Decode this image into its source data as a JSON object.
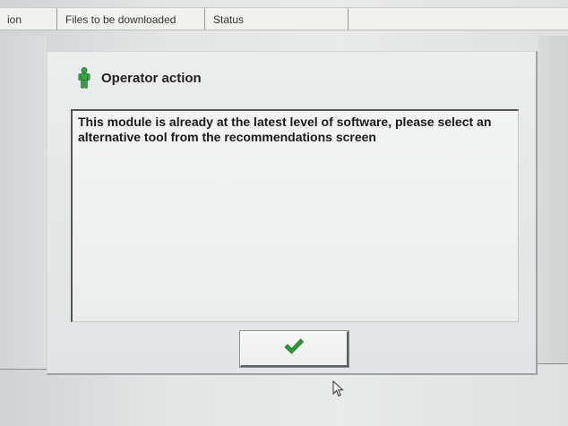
{
  "table_header": {
    "columns": [
      "ion",
      "Files to be downloaded",
      "Status",
      ""
    ]
  },
  "dialog": {
    "title": "Operator action",
    "icon": "person-icon",
    "message": "This module is already at the latest level of software, please select an alternative tool from the recommendations screen",
    "ok_button": {
      "icon": "checkmark-icon"
    }
  },
  "colors": {
    "checkmark": "#2f9a3c",
    "person_icon": "#3aa24a"
  }
}
